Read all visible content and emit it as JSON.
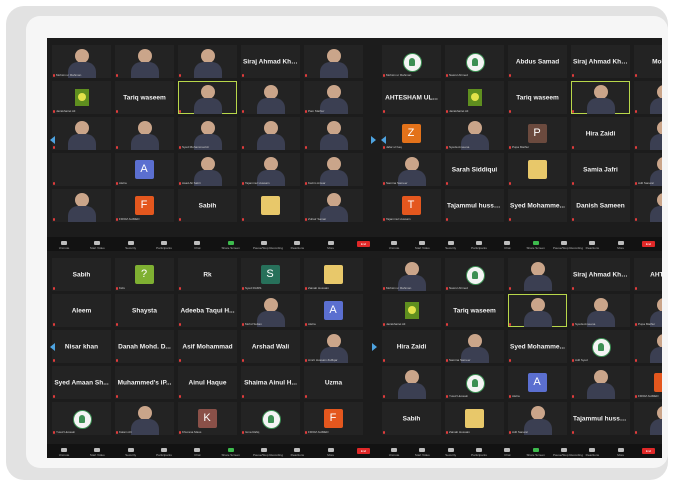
{
  "panels": [
    {
      "tiles": [
        {
          "kind": "vid",
          "label": "Mohsin ur Rahman"
        },
        {
          "kind": "vid",
          "label": ""
        },
        {
          "kind": "vid",
          "label": ""
        },
        {
          "kind": "name",
          "name": "Siraj Ahmad Khan"
        },
        {
          "kind": "vid",
          "label": ""
        },
        {
          "kind": "quran",
          "label": "Jazakhairet Ali"
        },
        {
          "kind": "name",
          "name": "Tariq waseem"
        },
        {
          "kind": "vid",
          "label": "",
          "hl": true
        },
        {
          "kind": "vid",
          "label": ""
        },
        {
          "kind": "vid",
          "label": "Pam Mathur"
        },
        {
          "kind": "vid",
          "label": ""
        },
        {
          "kind": "vid",
          "label": ""
        },
        {
          "kind": "vid",
          "label": "Syed Mohammad Ar"
        },
        {
          "kind": "vid",
          "label": ""
        },
        {
          "kind": "vid",
          "label": ""
        },
        {
          "kind": "name",
          "name": ""
        },
        {
          "kind": "sq",
          "letter": "A",
          "color": "#5b6fd0",
          "label": "Aleha"
        },
        {
          "kind": "vid",
          "label": "Asad Ali Sabri"
        },
        {
          "kind": "vid",
          "label": "Tajammul Hussain"
        },
        {
          "kind": "vid",
          "label": "Kazim Anwar"
        },
        {
          "kind": "vid",
          "label": ""
        },
        {
          "kind": "sq",
          "letter": "F",
          "color": "#e4571e",
          "label": "FIROZ AHMED"
        },
        {
          "kind": "name",
          "name": "Sabih"
        },
        {
          "kind": "sq",
          "letter": "",
          "color": "#e8c86a",
          "label": ""
        },
        {
          "kind": "vid",
          "label": "Zuhair Samar"
        }
      ]
    },
    {
      "tiles": [
        {
          "kind": "logo",
          "label": "Mohsin ur Rahman"
        },
        {
          "kind": "logo",
          "label": "Nasrul Ahmed"
        },
        {
          "kind": "name",
          "name": "Abdus Samad"
        },
        {
          "kind": "name",
          "name": "Siraj Ahmad Khan"
        },
        {
          "kind": "name",
          "name": "Moham"
        },
        {
          "kind": "name",
          "name": "AHTESHAM UL..."
        },
        {
          "kind": "quran",
          "label": "Jazakhairet Ali"
        },
        {
          "kind": "name",
          "name": "Tariq waseem"
        },
        {
          "kind": "vid",
          "label": "",
          "hl": true
        },
        {
          "kind": "vid",
          "label": ""
        },
        {
          "kind": "sq",
          "letter": "Z",
          "color": "#e3721a",
          "label": "Jafar ul haq"
        },
        {
          "kind": "vid",
          "label": "Syeda Ameena"
        },
        {
          "kind": "sq",
          "letter": "P",
          "color": "#6b4a3e",
          "label": "Pupa Mathur"
        },
        {
          "kind": "name",
          "name": "Hira Zaidi"
        },
        {
          "kind": "vid",
          "label": ""
        },
        {
          "kind": "vid",
          "label": "Samina Sameer"
        },
        {
          "kind": "name",
          "name": "Sarah Siddiqui"
        },
        {
          "kind": "sq",
          "letter": "",
          "color": "#e8c86a",
          "label": ""
        },
        {
          "kind": "name",
          "name": "Samia Jafri"
        },
        {
          "kind": "vid",
          "label": "Adil Sanwar"
        },
        {
          "kind": "sq",
          "letter": "T",
          "color": "#e4571e",
          "label": "Tajammul Hussain"
        },
        {
          "kind": "name",
          "name": "Tajammul hussain"
        },
        {
          "kind": "name",
          "name": "Syed Mohamme..."
        },
        {
          "kind": "name",
          "name": "Danish Sameen"
        },
        {
          "kind": "vid",
          "label": ""
        }
      ]
    },
    {
      "tiles": [
        {
          "kind": "name",
          "name": "Sabih"
        },
        {
          "kind": "sq",
          "letter": "?",
          "color": "#7fb032",
          "label": "Kids"
        },
        {
          "kind": "name",
          "name": "Rk"
        },
        {
          "kind": "sq",
          "letter": "S",
          "color": "#27705a",
          "label": "Syed RAMS"
        },
        {
          "kind": "sq",
          "letter": "",
          "color": "#e8c86a",
          "label": "Zainab Hussain"
        },
        {
          "kind": "name",
          "name": "Aleem"
        },
        {
          "kind": "name",
          "name": "Shaysta"
        },
        {
          "kind": "name",
          "name": "Adeeba Taqui H..."
        },
        {
          "kind": "vid",
          "label": "Mohd Sultan"
        },
        {
          "kind": "sq",
          "letter": "A",
          "color": "#5b6fd0",
          "label": "Aleha"
        },
        {
          "kind": "name",
          "name": "Nisar khan"
        },
        {
          "kind": "name",
          "name": "Danah Mohd. D..."
        },
        {
          "kind": "name",
          "name": "Asif Mohammad"
        },
        {
          "kind": "name",
          "name": "Arshad Wali"
        },
        {
          "kind": "vid",
          "label": "Amrit Hussain Zulfiqar"
        },
        {
          "kind": "name",
          "name": "Syed Amaan Sh..."
        },
        {
          "kind": "name",
          "name": "Muhammed's iP..."
        },
        {
          "kind": "name",
          "name": "Ainul Haque"
        },
        {
          "kind": "name",
          "name": "Shaima Ainul H..."
        },
        {
          "kind": "name",
          "name": "Uzma"
        },
        {
          "kind": "logo",
          "label": "Yusuf Hussain"
        },
        {
          "kind": "vid",
          "label": "Kalam Ali"
        },
        {
          "kind": "sq",
          "letter": "K",
          "color": "#8a5048",
          "label": "Khurana Mass"
        },
        {
          "kind": "logo",
          "label": "Isma Rafiq"
        },
        {
          "kind": "sq",
          "letter": "F",
          "color": "#e4571e",
          "label": "FIROZ AHMED"
        }
      ]
    },
    {
      "tiles": [
        {
          "kind": "vid",
          "label": "Mohsin ur Rahman"
        },
        {
          "kind": "logo",
          "label": "Nasrul Ahmed"
        },
        {
          "kind": "vid",
          "label": ""
        },
        {
          "kind": "name",
          "name": "Siraj Ahmad Khan"
        },
        {
          "kind": "name",
          "name": "AHTESH"
        },
        {
          "kind": "quran",
          "label": "Jazakhairet Ali"
        },
        {
          "kind": "name",
          "name": "Tariq waseem"
        },
        {
          "kind": "vid",
          "label": "",
          "hl": true
        },
        {
          "kind": "vid",
          "label": "Syeda Ameena"
        },
        {
          "kind": "vid",
          "label": "Pupa Mathur"
        },
        {
          "kind": "name",
          "name": "Hira Zaidi"
        },
        {
          "kind": "vid",
          "label": "Samina Sameer"
        },
        {
          "kind": "name",
          "name": "Syed Mohamme..."
        },
        {
          "kind": "logo",
          "label": "Adil Syed"
        },
        {
          "kind": "vid",
          "label": ""
        },
        {
          "kind": "vid",
          "label": ""
        },
        {
          "kind": "logo",
          "label": "Yusuf Hussain"
        },
        {
          "kind": "sq",
          "letter": "A",
          "color": "#5b6fd0",
          "label": "Aleha"
        },
        {
          "kind": "vid",
          "label": ""
        },
        {
          "kind": "sq",
          "letter": "",
          "color": "#e4571e",
          "label": "FIROZ AHMED"
        },
        {
          "kind": "name",
          "name": "Sabih"
        },
        {
          "kind": "sq",
          "letter": "",
          "color": "#e8c86a",
          "label": "Zainab Hussain"
        },
        {
          "kind": "vid",
          "label": "Adil Sanwar"
        },
        {
          "kind": "name",
          "name": "Tajammul hussain"
        },
        {
          "kind": "vid",
          "label": ""
        }
      ]
    }
  ],
  "toolbar": [
    "Unmute",
    "Start Video",
    "Security",
    "Participants",
    "Chat",
    "Share Screen",
    "Pause/Stop Recording",
    "Reactions",
    "More"
  ],
  "end_label": "End"
}
